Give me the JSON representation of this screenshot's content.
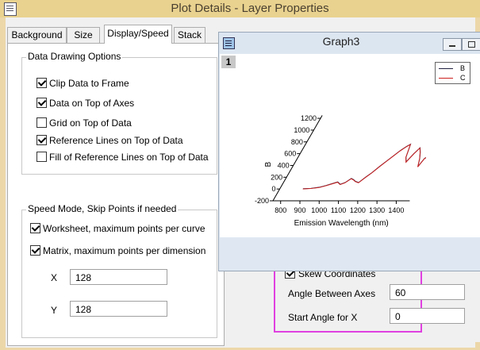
{
  "plot_details": {
    "title": "Plot Details - Layer Properties",
    "tabs": [
      "Background",
      "Size",
      "Display/Speed",
      "Stack"
    ],
    "active_tab": "Display/Speed",
    "data_drawing": {
      "title": "Data Drawing Options",
      "options": [
        {
          "label": "Clip Data to Frame",
          "checked": true
        },
        {
          "label": "Data on Top of Axes",
          "checked": true
        },
        {
          "label": "Grid on Top of Data",
          "checked": false
        },
        {
          "label": "Reference Lines on Top of Data",
          "checked": true
        },
        {
          "label": "Fill of Reference Lines on Top of Data",
          "checked": false
        }
      ]
    },
    "speed_mode": {
      "title": "Speed Mode, Skip Points if needed",
      "options": [
        {
          "label": "Worksheet, maximum points per curve",
          "checked": true
        },
        {
          "label": "Matrix, maximum points per dimension",
          "checked": true
        }
      ],
      "x_label": "X",
      "x_value": "128",
      "y_label": "Y",
      "y_value": "128"
    },
    "skew": {
      "checkbox_label": "Skew Coordinates",
      "checked": true,
      "angle_label": "Angle Between Axes",
      "angle_value": "60",
      "start_label": "Start Angle for X",
      "start_value": "0"
    },
    "highlight_color": "#e040e0"
  },
  "graph3": {
    "title": "Graph3",
    "layer_badge": "1",
    "legend": [
      {
        "name": "B",
        "color": "#202040"
      },
      {
        "name": "C",
        "color": "#cc2020"
      }
    ]
  },
  "chart_data": {
    "type": "line",
    "xlabel": "Emission Wavelength (nm)",
    "ylabel": "B",
    "x_ticks": [
      "800",
      "900",
      "1000",
      "1100",
      "1200",
      "1300",
      "1400"
    ],
    "y_ticks": [
      "-200",
      "0",
      "200",
      "400",
      "600",
      "800",
      "1000",
      "1200"
    ],
    "xlim": [
      760,
      1470
    ],
    "ylim": [
      -200,
      1250
    ],
    "skew_angle": 60,
    "series": [
      {
        "name": "B",
        "color": "#202040",
        "x": [
          880,
          920,
          960,
          990,
          1010,
          1040,
          1060,
          1080,
          1100,
          1115,
          1130,
          1150,
          1170,
          1190,
          1210,
          1230,
          1250,
          1270,
          1290,
          1305,
          1320,
          1335,
          1350,
          1365,
          1380,
          1395,
          1410,
          1420,
          1435,
          1450
        ],
        "y": [
          5,
          10,
          30,
          60,
          85,
          120,
          80,
          110,
          180,
          160,
          130,
          110,
          200,
          280,
          380,
          470,
          560,
          650,
          720,
          760,
          540,
          460,
          600,
          700,
          620,
          520,
          380,
          520,
          560,
          520
        ]
      },
      {
        "name": "C",
        "color": "#cc2020",
        "x": [
          880,
          920,
          960,
          990,
          1010,
          1040,
          1060,
          1080,
          1100,
          1115,
          1130,
          1150,
          1170,
          1190,
          1210,
          1230,
          1250,
          1270,
          1290,
          1305,
          1320,
          1335,
          1350,
          1365,
          1380,
          1395,
          1410,
          1420,
          1435,
          1450
        ],
        "y": [
          0,
          8,
          25,
          55,
          80,
          115,
          75,
          105,
          175,
          155,
          125,
          105,
          195,
          275,
          375,
          465,
          555,
          645,
          715,
          755,
          535,
          455,
          595,
          695,
          615,
          515,
          375,
          515,
          555,
          515
        ]
      }
    ]
  }
}
